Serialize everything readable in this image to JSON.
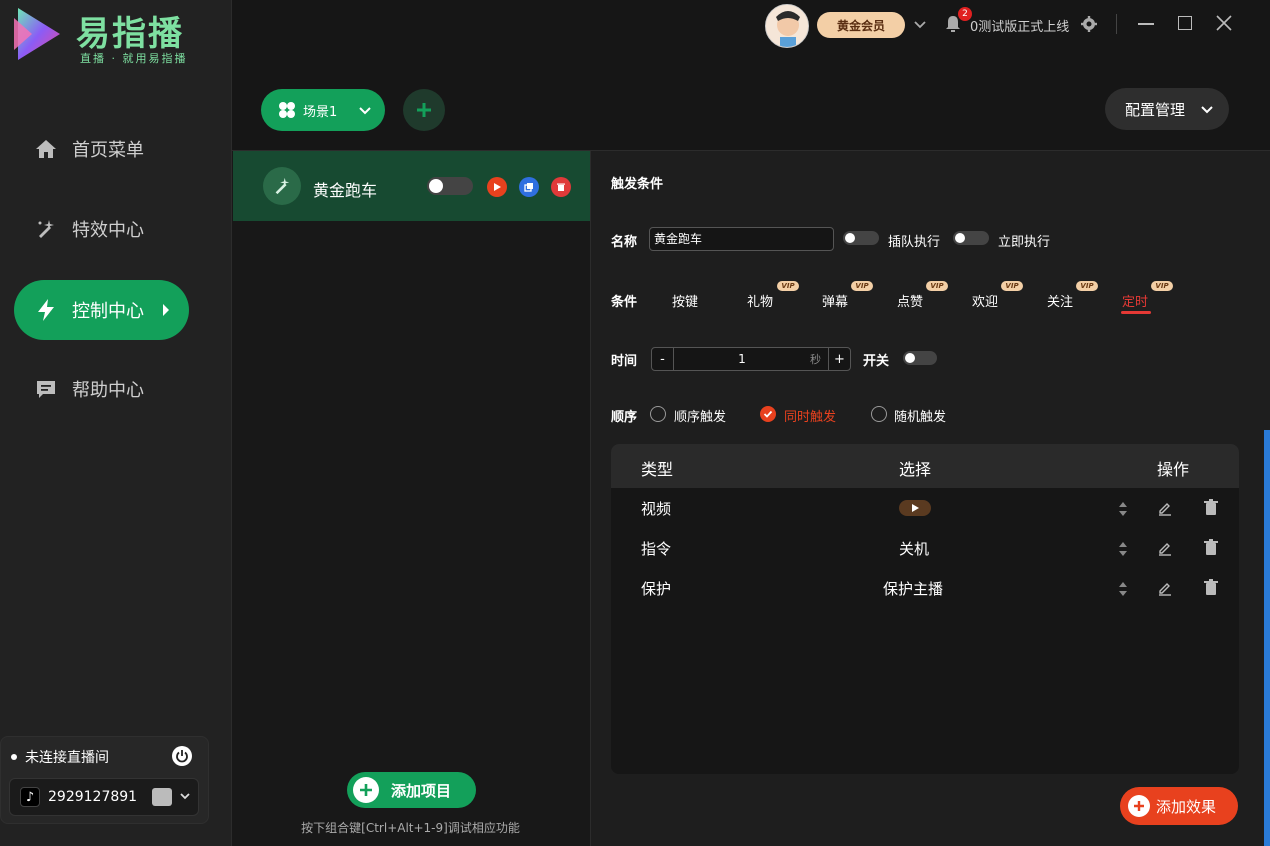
{
  "app": {
    "title": "易指播",
    "tagline": "直播 · 就用易指播"
  },
  "colors": {
    "accent_green": "#13a05a",
    "accent_red": "#e53935",
    "accent_orange": "#e8411e",
    "vip_gold": "#f3cfa6"
  },
  "sidebar": {
    "items": [
      {
        "label": "首页菜单",
        "icon": "home-icon"
      },
      {
        "label": "特效中心",
        "icon": "magic-icon"
      },
      {
        "label": "控制中心",
        "icon": "lightning-icon",
        "active": true
      },
      {
        "label": "帮助中心",
        "icon": "chat-icon"
      }
    ],
    "connection": {
      "status": "未连接直播间",
      "account_id": "2929127891",
      "platform_icon": "tiktok-icon"
    }
  },
  "topbar": {
    "member_badge": "黄金会员",
    "notification_count": "2",
    "marquee": "0测试版正式上线",
    "icons": [
      "settings-icon",
      "minimize-icon",
      "maximize-icon",
      "close-icon"
    ]
  },
  "scene": {
    "label": "场景1",
    "config_label": "配置管理"
  },
  "project_list": {
    "items": [
      {
        "name": "黄金跑车",
        "enabled": false
      }
    ],
    "add_label": "添加项目",
    "hint": "按下组合键[Ctrl+Alt+1-9]调试相应功能"
  },
  "trigger": {
    "section_title": "触发条件",
    "name_label": "名称",
    "name_value": "黄金跑车",
    "queue_label": "插队执行",
    "immediate_label": "立即执行",
    "condition_label": "条件",
    "conditions": [
      {
        "label": "按键",
        "vip": false
      },
      {
        "label": "礼物",
        "vip": true
      },
      {
        "label": "弹幕",
        "vip": true
      },
      {
        "label": "点赞",
        "vip": true
      },
      {
        "label": "欢迎",
        "vip": true
      },
      {
        "label": "关注",
        "vip": true
      },
      {
        "label": "定时",
        "vip": true,
        "active": true
      }
    ],
    "vip_tag": "VIP",
    "time_label": "时间",
    "time_value": "1",
    "time_unit": "秒",
    "minus": "-",
    "plus": "+",
    "switch_label": "开关",
    "order_label": "顺序",
    "order_options": [
      {
        "label": "顺序触发",
        "checked": false
      },
      {
        "label": "同时触发",
        "checked": true
      },
      {
        "label": "随机触发",
        "checked": false
      }
    ]
  },
  "effects_table": {
    "headers": [
      "类型",
      "选择",
      "操作"
    ],
    "rows": [
      {
        "type": "视频",
        "selection": ""
      },
      {
        "type": "指令",
        "selection": "关机"
      },
      {
        "type": "保护",
        "selection": "保护主播"
      }
    ],
    "add_label": "添加效果"
  }
}
